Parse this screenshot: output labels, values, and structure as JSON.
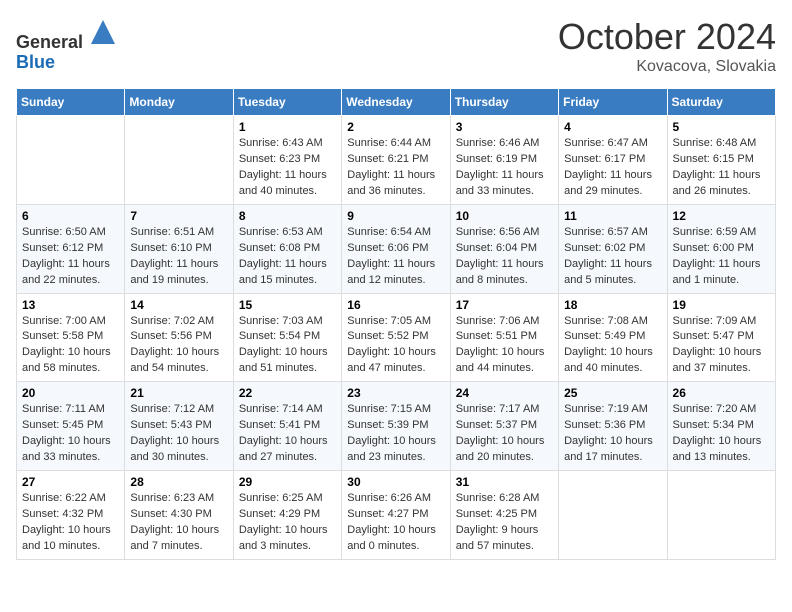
{
  "header": {
    "logo_line1": "General",
    "logo_line2": "Blue",
    "month_title": "October 2024",
    "location": "Kovacova, Slovakia"
  },
  "weekdays": [
    "Sunday",
    "Monday",
    "Tuesday",
    "Wednesday",
    "Thursday",
    "Friday",
    "Saturday"
  ],
  "weeks": [
    [
      {
        "day": "",
        "sunrise": "",
        "sunset": "",
        "daylight": ""
      },
      {
        "day": "",
        "sunrise": "",
        "sunset": "",
        "daylight": ""
      },
      {
        "day": "1",
        "sunrise": "Sunrise: 6:43 AM",
        "sunset": "Sunset: 6:23 PM",
        "daylight": "Daylight: 11 hours and 40 minutes."
      },
      {
        "day": "2",
        "sunrise": "Sunrise: 6:44 AM",
        "sunset": "Sunset: 6:21 PM",
        "daylight": "Daylight: 11 hours and 36 minutes."
      },
      {
        "day": "3",
        "sunrise": "Sunrise: 6:46 AM",
        "sunset": "Sunset: 6:19 PM",
        "daylight": "Daylight: 11 hours and 33 minutes."
      },
      {
        "day": "4",
        "sunrise": "Sunrise: 6:47 AM",
        "sunset": "Sunset: 6:17 PM",
        "daylight": "Daylight: 11 hours and 29 minutes."
      },
      {
        "day": "5",
        "sunrise": "Sunrise: 6:48 AM",
        "sunset": "Sunset: 6:15 PM",
        "daylight": "Daylight: 11 hours and 26 minutes."
      }
    ],
    [
      {
        "day": "6",
        "sunrise": "Sunrise: 6:50 AM",
        "sunset": "Sunset: 6:12 PM",
        "daylight": "Daylight: 11 hours and 22 minutes."
      },
      {
        "day": "7",
        "sunrise": "Sunrise: 6:51 AM",
        "sunset": "Sunset: 6:10 PM",
        "daylight": "Daylight: 11 hours and 19 minutes."
      },
      {
        "day": "8",
        "sunrise": "Sunrise: 6:53 AM",
        "sunset": "Sunset: 6:08 PM",
        "daylight": "Daylight: 11 hours and 15 minutes."
      },
      {
        "day": "9",
        "sunrise": "Sunrise: 6:54 AM",
        "sunset": "Sunset: 6:06 PM",
        "daylight": "Daylight: 11 hours and 12 minutes."
      },
      {
        "day": "10",
        "sunrise": "Sunrise: 6:56 AM",
        "sunset": "Sunset: 6:04 PM",
        "daylight": "Daylight: 11 hours and 8 minutes."
      },
      {
        "day": "11",
        "sunrise": "Sunrise: 6:57 AM",
        "sunset": "Sunset: 6:02 PM",
        "daylight": "Daylight: 11 hours and 5 minutes."
      },
      {
        "day": "12",
        "sunrise": "Sunrise: 6:59 AM",
        "sunset": "Sunset: 6:00 PM",
        "daylight": "Daylight: 11 hours and 1 minute."
      }
    ],
    [
      {
        "day": "13",
        "sunrise": "Sunrise: 7:00 AM",
        "sunset": "Sunset: 5:58 PM",
        "daylight": "Daylight: 10 hours and 58 minutes."
      },
      {
        "day": "14",
        "sunrise": "Sunrise: 7:02 AM",
        "sunset": "Sunset: 5:56 PM",
        "daylight": "Daylight: 10 hours and 54 minutes."
      },
      {
        "day": "15",
        "sunrise": "Sunrise: 7:03 AM",
        "sunset": "Sunset: 5:54 PM",
        "daylight": "Daylight: 10 hours and 51 minutes."
      },
      {
        "day": "16",
        "sunrise": "Sunrise: 7:05 AM",
        "sunset": "Sunset: 5:52 PM",
        "daylight": "Daylight: 10 hours and 47 minutes."
      },
      {
        "day": "17",
        "sunrise": "Sunrise: 7:06 AM",
        "sunset": "Sunset: 5:51 PM",
        "daylight": "Daylight: 10 hours and 44 minutes."
      },
      {
        "day": "18",
        "sunrise": "Sunrise: 7:08 AM",
        "sunset": "Sunset: 5:49 PM",
        "daylight": "Daylight: 10 hours and 40 minutes."
      },
      {
        "day": "19",
        "sunrise": "Sunrise: 7:09 AM",
        "sunset": "Sunset: 5:47 PM",
        "daylight": "Daylight: 10 hours and 37 minutes."
      }
    ],
    [
      {
        "day": "20",
        "sunrise": "Sunrise: 7:11 AM",
        "sunset": "Sunset: 5:45 PM",
        "daylight": "Daylight: 10 hours and 33 minutes."
      },
      {
        "day": "21",
        "sunrise": "Sunrise: 7:12 AM",
        "sunset": "Sunset: 5:43 PM",
        "daylight": "Daylight: 10 hours and 30 minutes."
      },
      {
        "day": "22",
        "sunrise": "Sunrise: 7:14 AM",
        "sunset": "Sunset: 5:41 PM",
        "daylight": "Daylight: 10 hours and 27 minutes."
      },
      {
        "day": "23",
        "sunrise": "Sunrise: 7:15 AM",
        "sunset": "Sunset: 5:39 PM",
        "daylight": "Daylight: 10 hours and 23 minutes."
      },
      {
        "day": "24",
        "sunrise": "Sunrise: 7:17 AM",
        "sunset": "Sunset: 5:37 PM",
        "daylight": "Daylight: 10 hours and 20 minutes."
      },
      {
        "day": "25",
        "sunrise": "Sunrise: 7:19 AM",
        "sunset": "Sunset: 5:36 PM",
        "daylight": "Daylight: 10 hours and 17 minutes."
      },
      {
        "day": "26",
        "sunrise": "Sunrise: 7:20 AM",
        "sunset": "Sunset: 5:34 PM",
        "daylight": "Daylight: 10 hours and 13 minutes."
      }
    ],
    [
      {
        "day": "27",
        "sunrise": "Sunrise: 6:22 AM",
        "sunset": "Sunset: 4:32 PM",
        "daylight": "Daylight: 10 hours and 10 minutes."
      },
      {
        "day": "28",
        "sunrise": "Sunrise: 6:23 AM",
        "sunset": "Sunset: 4:30 PM",
        "daylight": "Daylight: 10 hours and 7 minutes."
      },
      {
        "day": "29",
        "sunrise": "Sunrise: 6:25 AM",
        "sunset": "Sunset: 4:29 PM",
        "daylight": "Daylight: 10 hours and 3 minutes."
      },
      {
        "day": "30",
        "sunrise": "Sunrise: 6:26 AM",
        "sunset": "Sunset: 4:27 PM",
        "daylight": "Daylight: 10 hours and 0 minutes."
      },
      {
        "day": "31",
        "sunrise": "Sunrise: 6:28 AM",
        "sunset": "Sunset: 4:25 PM",
        "daylight": "Daylight: 9 hours and 57 minutes."
      },
      {
        "day": "",
        "sunrise": "",
        "sunset": "",
        "daylight": ""
      },
      {
        "day": "",
        "sunrise": "",
        "sunset": "",
        "daylight": ""
      }
    ]
  ]
}
